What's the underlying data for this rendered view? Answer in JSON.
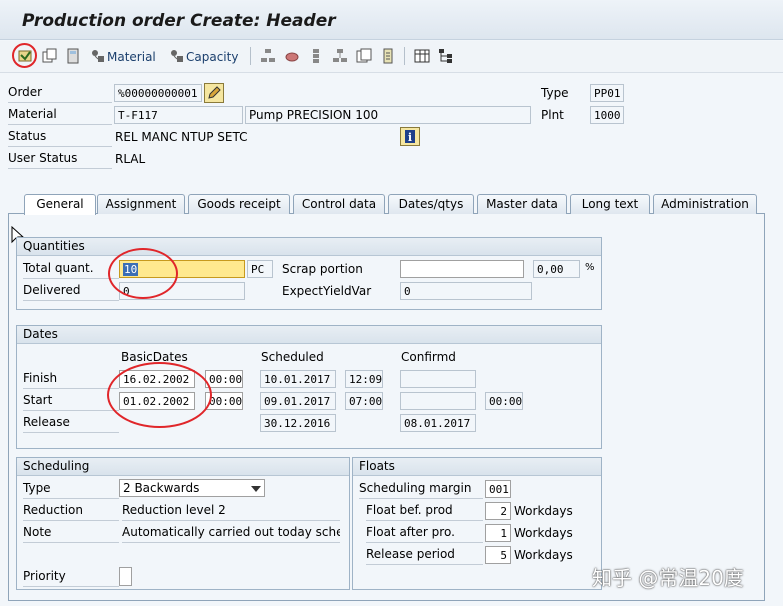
{
  "header": {
    "title": "Production order Create: Header"
  },
  "toolbar": {
    "material_label": "Material",
    "capacity_label": "Capacity"
  },
  "order": {
    "order_label": "Order",
    "order_value": "%00000000001",
    "type_label": "Type",
    "type_value": "PP01",
    "material_label": "Material",
    "material_value": "T-F117",
    "material_desc": "Pump PRECISION 100",
    "plant_label": "Plnt",
    "plant_value": "1000",
    "status_label": "Status",
    "status_value": "REL  MANC NTUP SETC",
    "user_status_label": "User Status",
    "user_status_value": "RLAL"
  },
  "tabs": [
    "General",
    "Assignment",
    "Goods receipt",
    "Control data",
    "Dates/qtys",
    "Master data",
    "Long text",
    "Administration"
  ],
  "quantities": {
    "title": "Quantities",
    "total_label": "Total quant.",
    "total_value": "10",
    "total_unit": "PC",
    "scrap_label": "Scrap portion",
    "scrap_value": "",
    "scrap_pct": "0,00",
    "scrap_pct_unit": "%",
    "delivered_label": "Delivered",
    "delivered_value": "0",
    "expect_label": "ExpectYieldVar",
    "expect_value": "0"
  },
  "dates": {
    "title": "Dates",
    "col_basic": "BasicDates",
    "col_scheduled": "Scheduled",
    "col_confirmed": "Confirmd",
    "finish_label": "Finish",
    "start_label": "Start",
    "release_label": "Release",
    "finish_basic_date": "16.02.2002",
    "finish_basic_time": "00:00",
    "finish_sched_date": "10.01.2017",
    "finish_sched_time": "12:09",
    "start_basic_date": "01.02.2002",
    "start_basic_time": "00:00",
    "start_sched_date": "09.01.2017",
    "start_sched_time": "07:00",
    "start_conf_time": "00:00",
    "release_sched_date": "30.12.2016",
    "release_conf_date": "08.01.2017"
  },
  "scheduling": {
    "title": "Scheduling",
    "type_label": "Type",
    "type_value": "2 Backwards",
    "reduction_label": "Reduction",
    "reduction_value": "Reduction level 2",
    "note_label": "Note",
    "note_value": "Automatically carried out today sched...",
    "priority_label": "Priority"
  },
  "floats": {
    "title": "Floats",
    "margin_label": "Scheduling margin",
    "margin_value": "001",
    "bef_label": "Float bef. prod",
    "bef_value": "2",
    "bef_unit": "Workdays",
    "after_label": "Float after pro.",
    "after_value": "1",
    "after_unit": "Workdays",
    "release_label": "Release period",
    "release_value": "5",
    "release_unit": "Workdays"
  },
  "watermark": "知乎 @常温20度",
  "colors": {
    "highlight": "#ffe98f",
    "annotation_red": "#e0262a",
    "tab_border": "#8fa4b9"
  }
}
